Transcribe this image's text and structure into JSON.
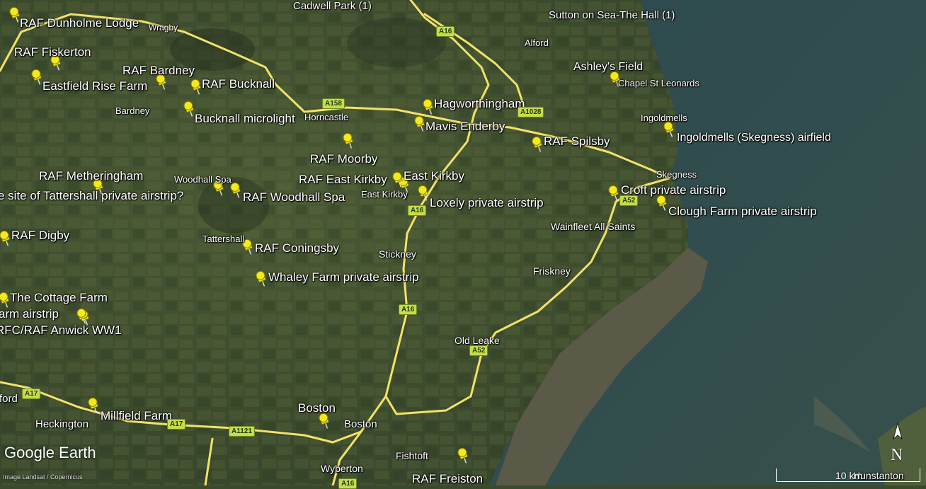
{
  "pins": [
    {
      "id": "raf-dunholme-lodge",
      "label": "RAF Dunholme Lodge"
    },
    {
      "id": "raf-fiskerton",
      "label": "RAF Fiskerton"
    },
    {
      "id": "raf-bardney",
      "label": "RAF Bardney"
    },
    {
      "id": "eastfield-rise-farm",
      "label": "Eastfield Rise Farm"
    },
    {
      "id": "raf-bucknall",
      "label": "RAF Bucknall"
    },
    {
      "id": "bucknall-microlight",
      "label": "Bucknall microlight"
    },
    {
      "id": "raf-metheringham",
      "label": "RAF Metheringham"
    },
    {
      "id": "tattershall-private-airstrip",
      "label": "e site of Tattershall private airstrip?"
    },
    {
      "id": "raf-woodhall-spa",
      "label": "RAF Woodhall Spa"
    },
    {
      "id": "raf-digby",
      "label": "RAF Digby"
    },
    {
      "id": "raf-coningsby",
      "label": "RAF Coningsby"
    },
    {
      "id": "whaley-farm",
      "label": "Whaley Farm private airstrip"
    },
    {
      "id": "the-cottage-farm",
      "label": "The Cottage Farm"
    },
    {
      "id": "farm-airstrip",
      "label": "arm airstrip"
    },
    {
      "id": "rfc-raf-anwick",
      "label": "RFC/RAF Anwick  WW1"
    },
    {
      "id": "millfield-farm",
      "label": "Millfield Farm"
    },
    {
      "id": "boston",
      "label": "Boston"
    },
    {
      "id": "raf-freiston",
      "label": "RAF Freiston"
    },
    {
      "id": "raf-moorby",
      "label": "RAF Moorby"
    },
    {
      "id": "raf-east-kirkby",
      "label": "RAF East Kirkby"
    },
    {
      "id": "east-kirkby",
      "label": "East Kirkby"
    },
    {
      "id": "loxely-private-airstrip",
      "label": "Loxely private airstrip"
    },
    {
      "id": "hagworthingham",
      "label": "Hagworthingham"
    },
    {
      "id": "mavis-enderby",
      "label": "Mavis Enderby"
    },
    {
      "id": "raf-spilsby",
      "label": "RAF Spilsby"
    },
    {
      "id": "ashleys-field",
      "label": "Ashley's Field"
    },
    {
      "id": "ingoldmells-airfield",
      "label": "Ingoldmells (Skegness) airfield"
    },
    {
      "id": "croft-private-airstrip",
      "label": "Croft private airstrip"
    },
    {
      "id": "clough-farm-private-airstrip",
      "label": "Clough Farm private airstrip"
    },
    {
      "id": "cadwell-park",
      "label": "Cadwell Park (1)"
    },
    {
      "id": "sutton-on-sea",
      "label": "Sutton on Sea-The Hall (1)"
    }
  ],
  "towns": [
    {
      "id": "wragby",
      "label": "Wragby"
    },
    {
      "id": "bardney",
      "label": "Bardney"
    },
    {
      "id": "horncastle",
      "label": "Horncastle"
    },
    {
      "id": "woodhall-spa",
      "label": "Woodhall Spa"
    },
    {
      "id": "tattershall",
      "label": "Tattershall"
    },
    {
      "id": "east-kirkby-town",
      "label": "East Kirkby"
    },
    {
      "id": "stickney",
      "label": "Stickney"
    },
    {
      "id": "friskney",
      "label": "Friskney"
    },
    {
      "id": "wainfleet",
      "label": "Wainfleet All Saints"
    },
    {
      "id": "skegness",
      "label": "Skegness"
    },
    {
      "id": "ingoldmells",
      "label": "Ingoldmells"
    },
    {
      "id": "chapel-st-leonards",
      "label": "Chapel St Leonards"
    },
    {
      "id": "alford",
      "label": "Alford"
    },
    {
      "id": "old-leake",
      "label": "Old Leake"
    },
    {
      "id": "boston-town",
      "label": "Boston"
    },
    {
      "id": "fishtoft",
      "label": "Fishtoft"
    },
    {
      "id": "wyberton",
      "label": "Wyberton"
    },
    {
      "id": "heckington",
      "label": "Heckington"
    },
    {
      "id": "sleaford",
      "label": "ford"
    },
    {
      "id": "hunstanton",
      "label": "Hunstanton"
    }
  ],
  "roads": [
    {
      "id": "a16-north",
      "label": "A16"
    },
    {
      "id": "a158",
      "label": "A158"
    },
    {
      "id": "a1028",
      "label": "A1028"
    },
    {
      "id": "a16-mid",
      "label": "A16"
    },
    {
      "id": "a52-east",
      "label": "A52"
    },
    {
      "id": "a16-south",
      "label": "A16"
    },
    {
      "id": "a52-south",
      "label": "A52"
    },
    {
      "id": "a17-west",
      "label": "A17"
    },
    {
      "id": "a17-mid",
      "label": "A17"
    },
    {
      "id": "a1121",
      "label": "A1121"
    },
    {
      "id": "a16-bottom",
      "label": "A16"
    }
  ],
  "branding": {
    "logo": "Google Earth",
    "credit": "Image Landsat / Copernicus"
  },
  "scale": {
    "text": "10 km"
  },
  "compass": {
    "letter": "N"
  },
  "colors": {
    "road": "#f2e26a",
    "pin": "#f3ea1c",
    "sea": "#2f4a4c",
    "land": "#3e4f2e",
    "mudflat": "#8a6a4a"
  }
}
